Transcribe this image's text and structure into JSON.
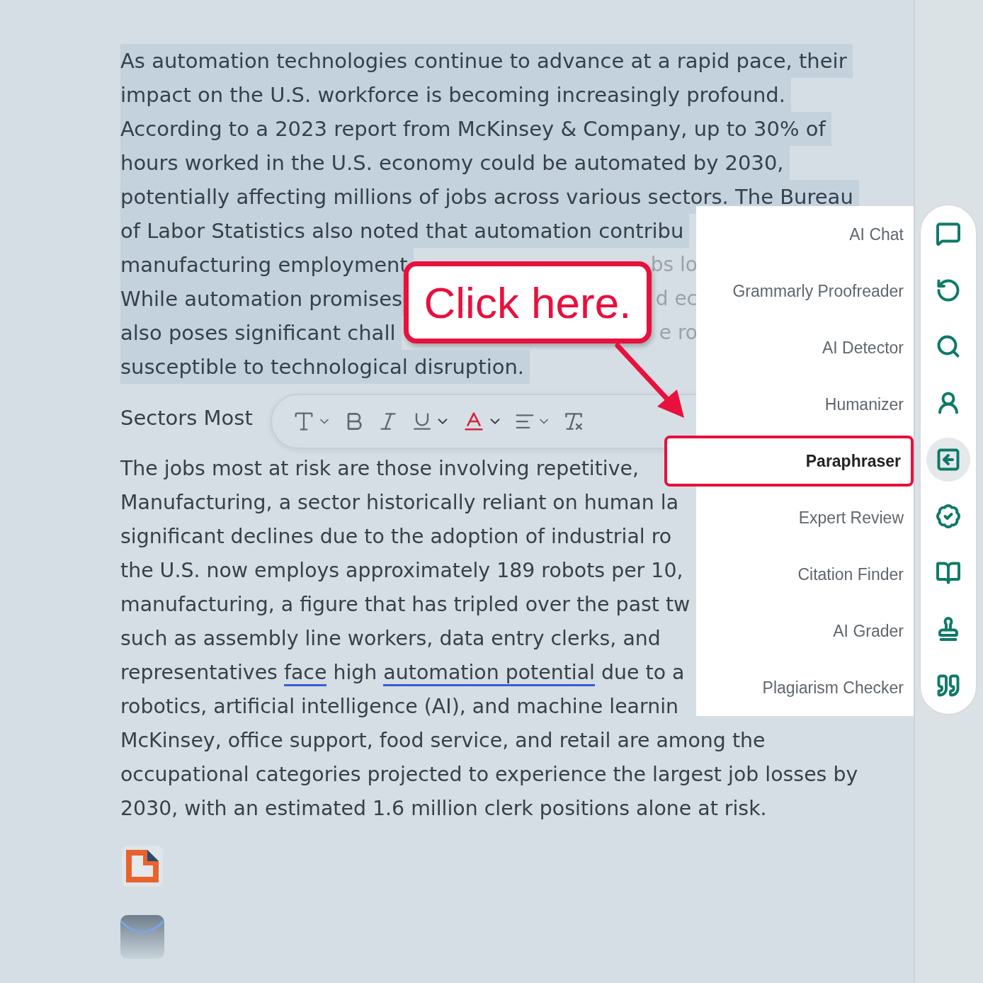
{
  "document": {
    "intro_lines": [
      {
        "text": "As automation technologies continue to advance at a rapid pace, their"
      },
      {
        "text": "impact on the U.S. workforce is becoming increasingly profound."
      },
      {
        "text": "According to a 2023 report from McKinsey & Company, up to 30% of"
      },
      {
        "text": "hours worked in the U.S. economy could be automated by 2030,"
      },
      {
        "text": "potentially affecting millions of jobs across various sectors. The Bureau"
      },
      {
        "text": "of Labor Statistics also noted that automation contribu"
      },
      {
        "text": "manufacturing employment",
        "tail": "bs lo"
      },
      {
        "text": "While automation promises",
        "tail": "d ec"
      },
      {
        "text": "also poses significant chall",
        "tail": "e ro"
      },
      {
        "text": "susceptible to technological disruption."
      }
    ],
    "intro_selected": true,
    "heading": "Sectors Most",
    "body_lines": [
      [
        {
          "text": "The jobs most at risk are those involving repetitive,",
          "underlined": false
        }
      ],
      [
        {
          "text": "Manufacturing, a sector historically reliant on human la",
          "underlined": false
        }
      ],
      [
        {
          "text": "significant declines due to the adoption of industrial ro",
          "underlined": false
        }
      ],
      [
        {
          "text": "the U.S. now employs approximately 189 robots per 10,",
          "underlined": false
        }
      ],
      [
        {
          "text": "manufacturing, a figure that has tripled over the past tw",
          "underlined": false
        }
      ],
      [
        {
          "text": "such as assembly line workers, data entry clerks, and",
          "underlined": false
        }
      ],
      [
        {
          "text": "representatives ",
          "underlined": false
        },
        {
          "text": "face",
          "underlined": true
        },
        {
          "text": " high ",
          "underlined": false
        },
        {
          "text": "automation potential",
          "underlined": true
        },
        {
          "text": " due to a",
          "underlined": false
        }
      ],
      [
        {
          "text": "robotics, artificial intelligence (AI), and machine learnin",
          "underlined": false
        }
      ],
      [
        {
          "text": "McKinsey, office support, food service, and retail are among the",
          "underlined": false
        }
      ],
      [
        {
          "text": "occupational categories projected to experience the largest job losses by",
          "underlined": false
        }
      ],
      [
        {
          "text": "2030, with an estimated 1.6 million clerk positions alone at risk.",
          "underlined": false
        }
      ]
    ]
  },
  "callout": {
    "text": "Click here."
  },
  "tools_menu": [
    {
      "label": "AI Chat",
      "selected": false
    },
    {
      "label": "Grammarly Proofreader",
      "selected": false
    },
    {
      "label": "AI Detector",
      "selected": false
    },
    {
      "label": "Humanizer",
      "selected": false
    },
    {
      "label": "Paraphraser",
      "selected": true
    },
    {
      "label": "Expert Review",
      "selected": false
    },
    {
      "label": "Citation Finder",
      "selected": false
    },
    {
      "label": "AI Grader",
      "selected": false
    },
    {
      "label": "Plagiarism Checker",
      "selected": false
    }
  ]
}
